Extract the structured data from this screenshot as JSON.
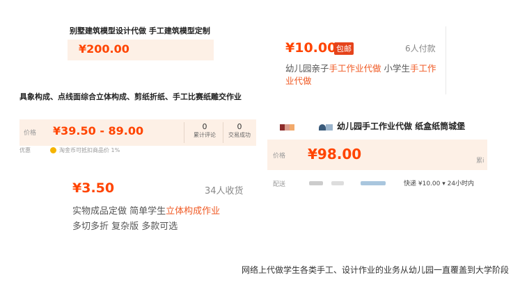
{
  "card1": {
    "title": "别墅建筑模型设计代做 手工建筑模型定制",
    "price": "¥200.00"
  },
  "card2": {
    "price": "¥10.00",
    "badge": "包邮",
    "paid_count": "6人付款",
    "desc_parts": [
      "幼儿园亲子",
      "手工作业代做",
      " 小学生",
      "手工作业代做"
    ]
  },
  "card3": {
    "title": "具象构成、点线面综合立体构成、剪纸折纸、手工比赛纸雕交作业",
    "price_label": "价格",
    "price": "¥39.50 - 89.00",
    "stats": [
      {
        "num": "0",
        "label": "累计评论"
      },
      {
        "num": "0",
        "label": "交易成功"
      }
    ],
    "tail_label": "优惠",
    "tail_text": "淘金币可抵扣商品价 1%"
  },
  "card4": {
    "title": "幼儿园手工作业代做 纸盒纸筒城堡",
    "price_label": "价格",
    "price": "¥98.00",
    "sales_label": "累i",
    "ship_label": "配送",
    "ship_info": "快递 ¥10.00 ▾ 24小时内"
  },
  "card5": {
    "price": "¥3.50",
    "buyers": "34人收货",
    "desc_parts": [
      "实物成品定做 简单学生",
      "立体构成作业",
      "多切多折 复杂版 多款可选"
    ]
  },
  "caption": "网络上代做学生各类手工、设计作业的业务从幼儿园一直覆盖到大学阶段"
}
